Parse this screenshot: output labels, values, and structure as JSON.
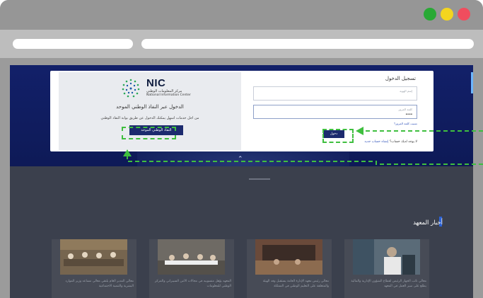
{
  "colors": {
    "hero": "#122069",
    "primary_button": "#1c2a6e",
    "highlight": "#3fbf3f",
    "window_green": "#29a935",
    "window_yellow": "#f3d51f",
    "window_red": "#f04d5e"
  },
  "nic": {
    "logo_text": "NIC",
    "logo_arabic": "مركز المعلومات الوطني",
    "logo_english": "National Information Center",
    "heading": "الدخول عبر النفاذ الوطني الموحد",
    "description": "من اجل خدمات اسهل يمكنك الدخول عن طريق بوابة النفاذ الوطني",
    "button_label": "النفاذ الوطني الموحد"
  },
  "login": {
    "title": "تسجيل الدخول",
    "username_placeholder": "إسم الهوية",
    "password_label": "كلمة المرور",
    "password_value": "••••",
    "forgot_password": "نسيت كلمة المرور؟",
    "submit_label": "دخول",
    "no_account_text": "لا يوجد لديك حساب؟",
    "register_link": "إنشاء حساب جديد"
  },
  "news": {
    "section_title": "أخبار المعهد",
    "items": [
      {
        "text": "معالي نائب الجهاز الرئيس لقطاع الشؤون الإدارية والمالية يطلع على سير العمل في المعهد"
      },
      {
        "text": "معالي رئيس معهد الإدارة العامة يستقبل وفد الهيئة والمتعلقة على التعليم الوطني في المملكة"
      },
      {
        "text": "المعهد يؤهل منسوبيه في مجالات الأمن السيبراني والمركز الوطني للمعلومات"
      },
      {
        "text": "معالي المدير العام يلتقي معالي مساعد وزير الموارد البشرية والتنمية الاجتماعية"
      }
    ]
  }
}
